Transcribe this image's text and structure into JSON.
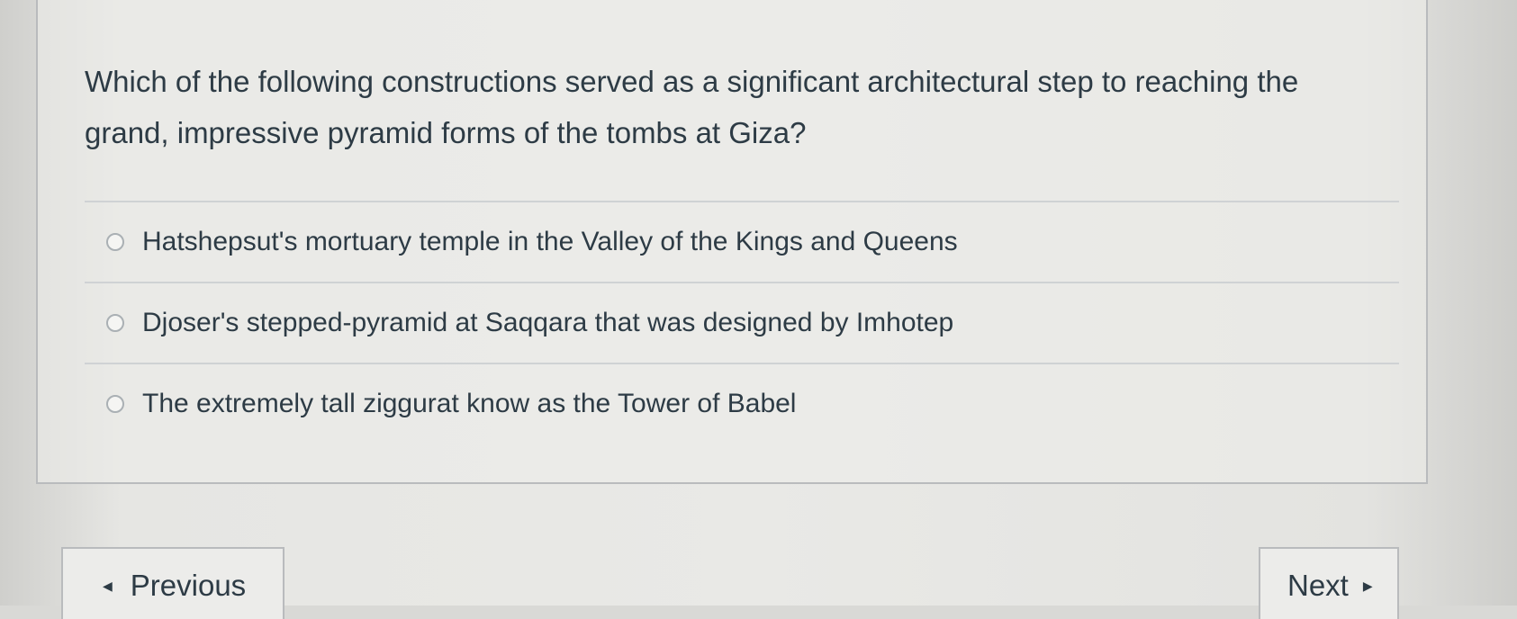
{
  "question": {
    "text": "Which of the following constructions served as a significant architectural step to reaching the grand, impressive pyramid forms of the tombs at Giza?"
  },
  "answers": [
    {
      "label": "Hatshepsut's mortuary temple in the Valley of the Kings and Queens",
      "selected": false
    },
    {
      "label": "Djoser's stepped-pyramid at Saqqara that was designed by Imhotep",
      "selected": false
    },
    {
      "label": "The extremely tall ziggurat know as the Tower of Babel",
      "selected": false
    }
  ],
  "navigation": {
    "previous_label": "Previous",
    "next_label": "Next",
    "previous_icon": "caret-left-icon",
    "next_icon": "caret-right-icon"
  }
}
